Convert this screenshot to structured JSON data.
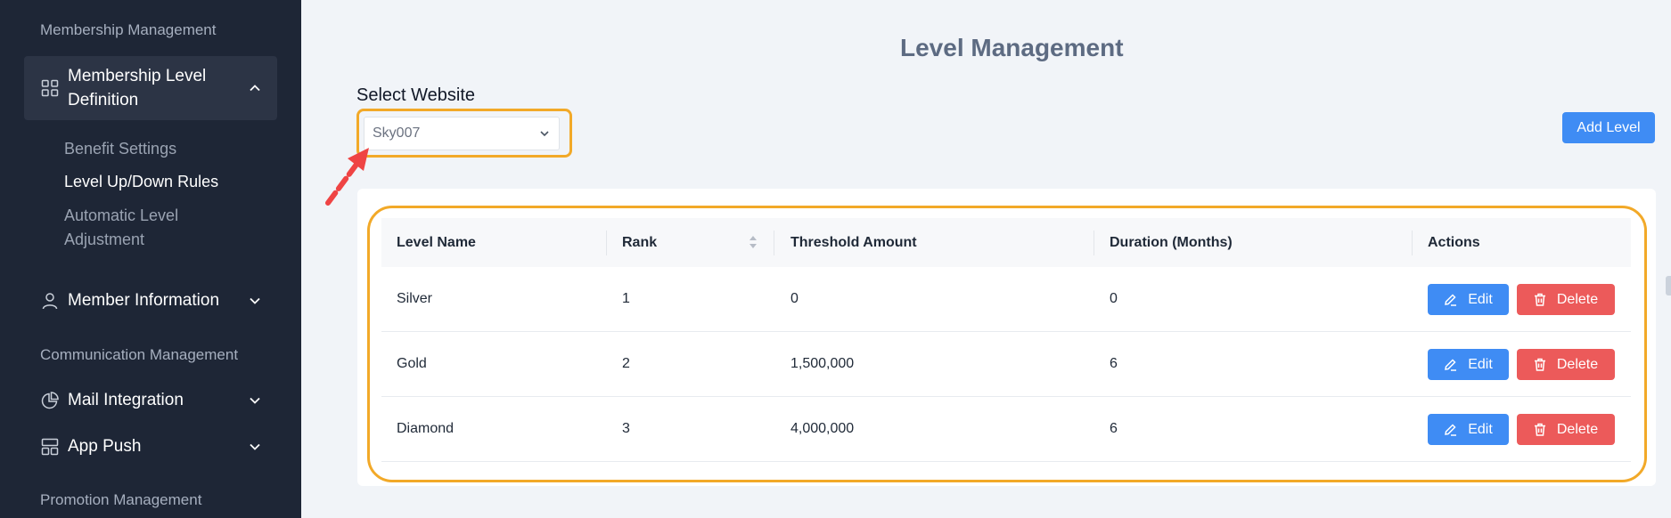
{
  "sidebar": {
    "section_membership": "Membership Management",
    "membership_level_definition": "Membership Level Definition",
    "sub_benefit_settings": "Benefit Settings",
    "sub_level_rules": "Level Up/Down Rules",
    "sub_auto_adjust": "Automatic Level Adjustment",
    "member_information": "Member Information",
    "section_communication": "Communication Management",
    "mail_integration": "Mail Integration",
    "app_push": "App Push",
    "section_promotion": "Promotion Management"
  },
  "main": {
    "title": "Level Management",
    "select_label": "Select Website",
    "select_value": "Sky007",
    "add_button": "Add Level",
    "table": {
      "headers": [
        "Level Name",
        "Rank",
        "Threshold Amount",
        "Duration (Months)",
        "Actions"
      ],
      "rows": [
        [
          "Silver",
          "1",
          "0",
          "0"
        ],
        [
          "Gold",
          "2",
          "1,500,000",
          "6"
        ],
        [
          "Diamond",
          "3",
          "4,000,000",
          "6"
        ]
      ],
      "edit_label": "Edit",
      "delete_label": "Delete"
    }
  },
  "colors": {
    "sidebar_bg": "#1e2636",
    "primary": "#3f8cf4",
    "danger": "#ec5a5a",
    "highlight": "#f2a928",
    "annotation_arrow": "#ef4444"
  }
}
